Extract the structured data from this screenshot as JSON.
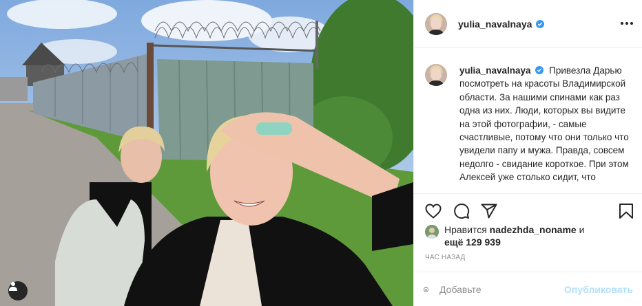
{
  "post": {
    "author": "yulia_navalnaya",
    "verified": true,
    "caption": "Привезла Дарью посмотреть на красоты Владимирской области. За нашими спинами как раз одна из них. Люди, которых вы видите на этой фотографии, - самые счастливые, потому что они только что увидели папу и мужа. Правда, совсем недолго - свидание короткое. При этом Алексей уже столько сидит, что",
    "likes_prefix": "Нравится",
    "liked_by": "nadezhda_noname",
    "likes_and": "и",
    "likes_more": "ещё 129 939",
    "time": "час назад"
  },
  "comment": {
    "placeholder": "Добавьте",
    "publish_label": "Опубликовать"
  },
  "icons": {
    "more": "more-options-icon",
    "like": "heart-icon",
    "comment": "comment-icon",
    "share": "paper-plane-icon",
    "save": "bookmark-icon",
    "emoji": "emoji-icon",
    "tag": "user-tag-icon",
    "verified": "verified-badge-icon"
  },
  "colors": {
    "text": "#262626",
    "muted": "#8e8e8e",
    "verified": "#3897f0",
    "publish_disabled": "#b2dffc",
    "divider": "#efefef"
  }
}
